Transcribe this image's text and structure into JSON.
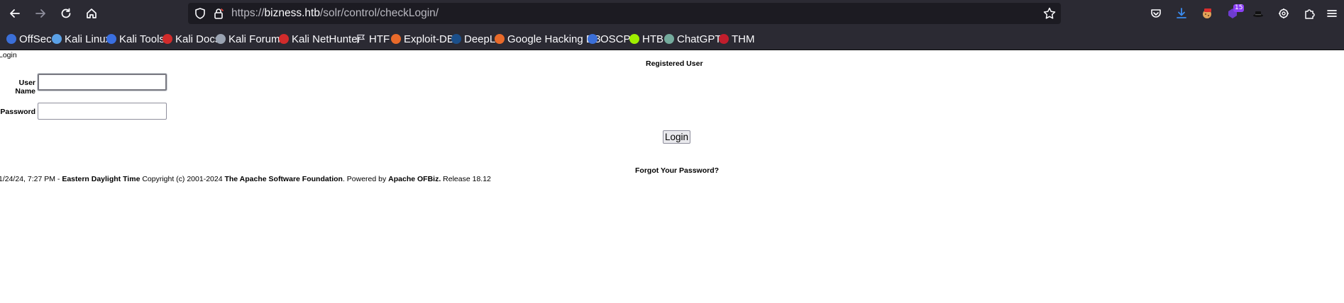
{
  "browser": {
    "url_scheme": "https://",
    "url_host": "bizness.htb",
    "url_path": "/solr/control/checkLogin/",
    "extensions_badge": "15",
    "bookmarks": [
      {
        "label": "OffSec",
        "icon": "offsec-icon",
        "color": "#3b6fd8"
      },
      {
        "label": "Kali Linux",
        "icon": "kali-linux-icon",
        "color": "#5aa0e6"
      },
      {
        "label": "Kali Tools",
        "icon": "kali-tools-icon",
        "color": "#3a6fe0"
      },
      {
        "label": "Kali Docs",
        "icon": "kali-docs-icon",
        "color": "#d12b2b"
      },
      {
        "label": "Kali Forums",
        "icon": "kali-forums-icon",
        "color": "#9aa3b2"
      },
      {
        "label": "Kali NetHunter",
        "icon": "kali-nethunter-icon",
        "color": "#d12b2b"
      },
      {
        "label": "HTF",
        "icon": "flag-icon",
        "color": "#cfcfd6"
      },
      {
        "label": "Exploit-DB",
        "icon": "exploit-db-icon",
        "color": "#e86a2a"
      },
      {
        "label": "DeepL",
        "icon": "deepl-icon",
        "color": "#1b4f8a"
      },
      {
        "label": "Google Hacking DB",
        "icon": "ghdb-icon",
        "color": "#e86a2a"
      },
      {
        "label": "OSCP",
        "icon": "oscp-icon",
        "color": "#3b6fd8"
      },
      {
        "label": "HTB",
        "icon": "htb-icon",
        "color": "#9fef00"
      },
      {
        "label": "ChatGPT",
        "icon": "chatgpt-icon",
        "color": "#74aa9c"
      },
      {
        "label": "THM",
        "icon": "thm-icon",
        "color": "#c11d2c"
      }
    ]
  },
  "page": {
    "breadcrumb": "Login",
    "registered_user_title": "Registered User",
    "username_label": "User Name",
    "username_value": "",
    "password_label": "Password",
    "password_value": "",
    "login_button": "Login",
    "forgot_password": "Forgot Your Password?",
    "footer": {
      "timestamp": "1/24/24, 7:27 PM - ",
      "timezone": "Eastern Daylight Time",
      "copyright": " Copyright (c) 2001-2024 ",
      "asf": "The Apache Software Foundation",
      "powered": ". Powered by ",
      "ofbiz": "Apache OFBiz.",
      "release": " Release 18.12"
    }
  }
}
